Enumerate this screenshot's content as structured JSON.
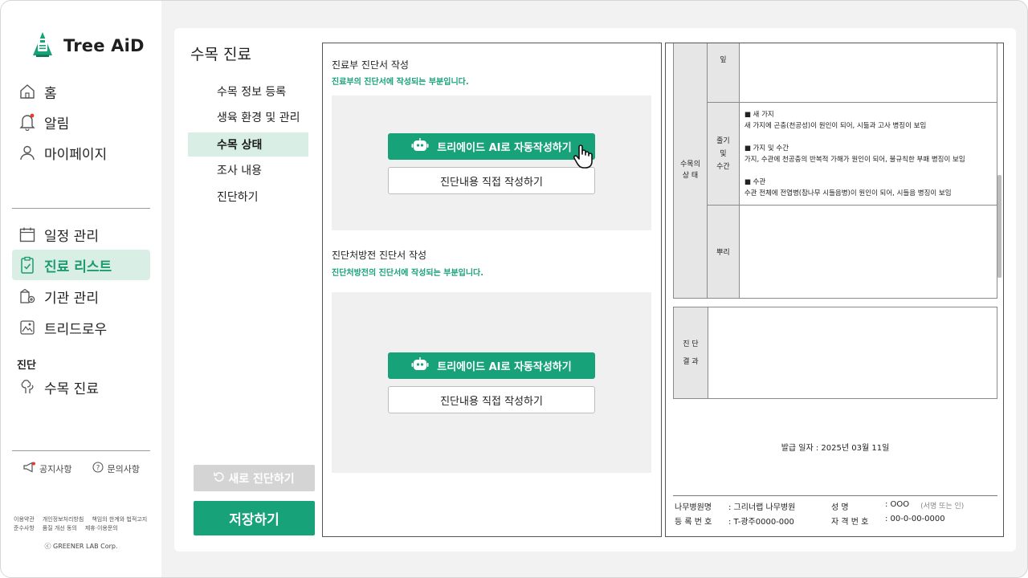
{
  "app": {
    "name": "Tree AiD",
    "brand_color": "#18a27a",
    "active_bg": "#d9efe6"
  },
  "sidebar": {
    "top_items": [
      {
        "label": "홈",
        "icon": "home-icon"
      },
      {
        "label": "알림",
        "icon": "bell-icon"
      },
      {
        "label": "마이페이지",
        "icon": "user-icon"
      }
    ],
    "work_items": [
      {
        "label": "일정 관리",
        "icon": "calendar-icon"
      },
      {
        "label": "진료 리스트",
        "icon": "clipboard-icon",
        "active": true
      },
      {
        "label": "기관 관리",
        "icon": "building-icon"
      },
      {
        "label": "트리드로우",
        "icon": "image-icon"
      }
    ],
    "section_label": "진단",
    "diag_item": {
      "label": "수목 진료",
      "icon": "tree-icon"
    },
    "footer": {
      "notice": "공지사항",
      "inquiry": "문의사항"
    },
    "legal": {
      "row1": [
        "이용약관",
        "개인정보처리방침",
        "책임의 한계와 법적고지"
      ],
      "row2": [
        "준수사항",
        "품질 개선 동의",
        "제휴·이용문의"
      ]
    },
    "copyright": "ⓒ GREENER LAB Corp."
  },
  "main": {
    "title": "수목 진료",
    "subnav": [
      "수목 정보 등록",
      "생육 환경 및 관리",
      "수목 상태",
      "조사 내용",
      "진단하기"
    ],
    "active_subnav": "수목 상태",
    "new_button": "새로 진단하기",
    "save_button": "저장하기"
  },
  "form": {
    "section1": {
      "title": "진료부 진단서 작성",
      "subtitle": "진료부의 진단서에 작성되는 부분입니다.",
      "ai_button": "트리에이드 AI로 자동작성하기",
      "direct_button": "진단내용 직접 작성하기"
    },
    "section2": {
      "title": "진단처방전 진단서 작성",
      "subtitle": "진단처방전의 진단서에 작성되는 부분입니다.",
      "ai_button": "트리에이드 AI로 자동작성하기",
      "direct_button": "진단내용 직접 작성하기"
    }
  },
  "document": {
    "status_label_1": "수목의",
    "status_label_2": "상    태",
    "leaf": "잎",
    "stem_1": "줄기",
    "stem_2": "및",
    "stem_3": "수간",
    "stem_content": [
      "■ 새 가지",
      "새 가지에 곤충(천공성)이 원인이 되어, 시듦과 고사 병징이 보임",
      "",
      "■ 가지 및 수간",
      "가지, 수관에 천공충의 반복적 가해가 원인이 되어, 불규칙한 부패 병징이 보임",
      "",
      "■ 수관",
      "수관 전체에 전엽병(참나무 시들음병)이 원인이 되어, 시들음 병징이 보임"
    ],
    "root": "뿌리",
    "result_1": "진    단",
    "result_2": "결    과",
    "issue_date": "발급 일자 : 2025년 03월 11일",
    "hospital_label": "나무병원명",
    "hospital_value": ":  그리너랩 나무병원",
    "name_label": "성          명",
    "name_value": ":  OOO",
    "sign_note": "(서명 또는 인)",
    "reg_label": "등 록 번 호",
    "reg_value": ":  T-광주0000-000",
    "license_label": "자 격 번 호",
    "license_value": ":  00-0-00-0000"
  }
}
